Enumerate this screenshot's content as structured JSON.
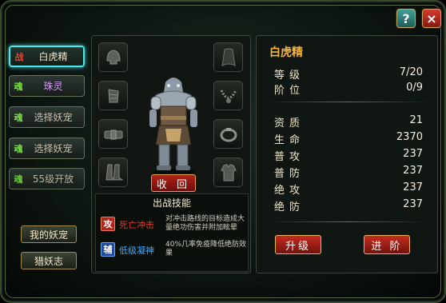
{
  "header": {
    "help_label": "?",
    "close_label": "×"
  },
  "sidebar": {
    "tabs": [
      {
        "glyph": "战",
        "label": "白虎精"
      },
      {
        "glyph": "魂",
        "label": "珠灵"
      },
      {
        "glyph": "魂",
        "label": "选择妖宠"
      },
      {
        "glyph": "魂",
        "label": "选择妖宠"
      },
      {
        "glyph": "魂",
        "label": "55级开放"
      }
    ],
    "my_pets_label": "我的妖宠",
    "hunt_log_label": "猎妖志"
  },
  "center": {
    "recall_label": "收 回",
    "skills_title": "出战技能",
    "skills": [
      {
        "icon_text": "攻",
        "name": "死亡冲击",
        "desc": "对冲击路线的目标造成大量绝功伤害并附加眩晕",
        "color": "#e03a2a"
      },
      {
        "icon_text": "辅",
        "name": "低级凝神",
        "desc": "40%几率免疫降低绝防效果",
        "color": "#4aa8f0"
      }
    ],
    "equipment_slots": [
      "helmet-icon",
      "bracer-icon",
      "belt-icon",
      "boots-icon",
      "cloak-icon",
      "necklace-icon",
      "ring-icon",
      "armor-icon"
    ]
  },
  "stats": {
    "pet_name": "白虎精",
    "rows": [
      {
        "label": "等级",
        "value": "7/20"
      },
      {
        "label": "阶位",
        "value": "0/9"
      },
      {
        "label": "资质",
        "value": "21"
      },
      {
        "label": "生命",
        "value": "2370"
      },
      {
        "label": "普攻",
        "value": "237"
      },
      {
        "label": "普防",
        "value": "237"
      },
      {
        "label": "绝攻",
        "value": "237"
      },
      {
        "label": "绝防",
        "value": "237"
      }
    ],
    "upgrade_label": "升级",
    "advance_label": "进 阶"
  },
  "colors": {
    "accent_gold": "#f7b53f",
    "active_tab_glow": "#4ee6e6",
    "button_red": "#b3201a"
  }
}
